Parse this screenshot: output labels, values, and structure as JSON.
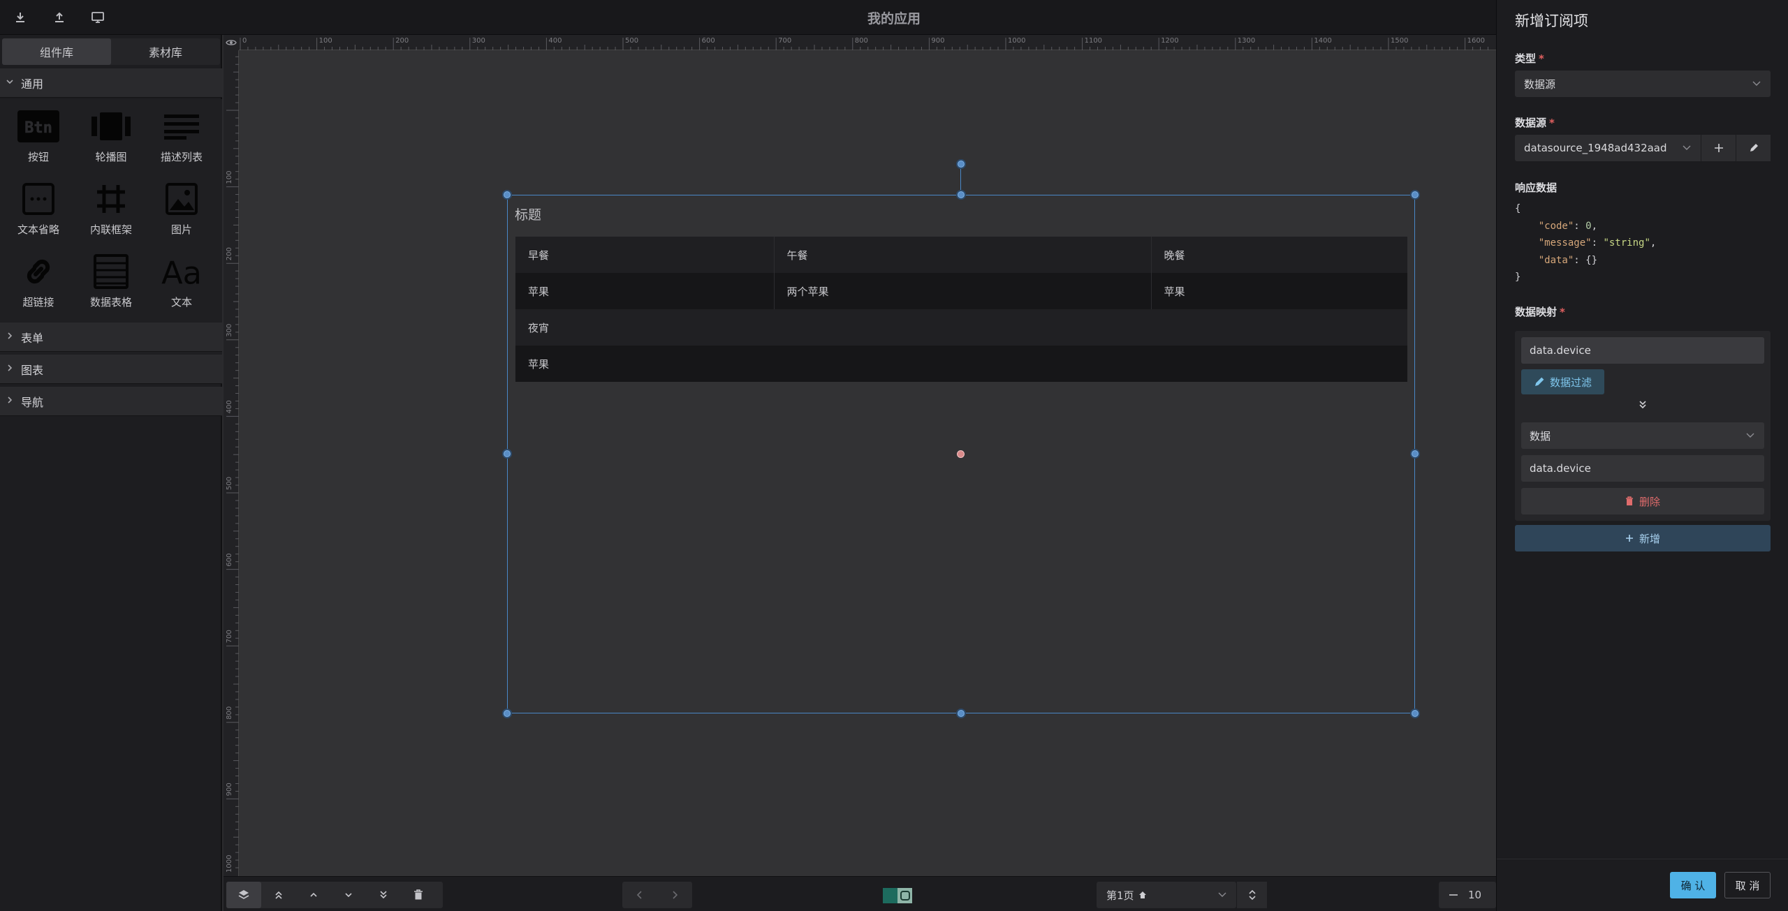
{
  "app": {
    "title": "我的应用"
  },
  "toolbar": {
    "icons": [
      "download-icon",
      "upload-icon",
      "preview-icon"
    ]
  },
  "library": {
    "tabs": [
      {
        "label": "组件库",
        "active": true
      },
      {
        "label": "素材库",
        "active": false
      }
    ],
    "sections": [
      {
        "label": "通用",
        "expanded": true
      },
      {
        "label": "表单",
        "expanded": false
      },
      {
        "label": "图表",
        "expanded": false
      },
      {
        "label": "导航",
        "expanded": false
      }
    ],
    "components": [
      {
        "label": "按钮",
        "icon": "button-icon",
        "icon_text": "Btn"
      },
      {
        "label": "轮播图",
        "icon": "carousel-icon"
      },
      {
        "label": "描述列表",
        "icon": "description-list-icon"
      },
      {
        "label": "文本省略",
        "icon": "text-ellipsis-icon"
      },
      {
        "label": "内联框架",
        "icon": "iframe-icon"
      },
      {
        "label": "图片",
        "icon": "image-icon"
      },
      {
        "label": "超链接",
        "icon": "link-icon"
      },
      {
        "label": "数据表格",
        "icon": "data-table-icon"
      },
      {
        "label": "文本",
        "icon": "text-icon",
        "icon_text": "Aa"
      }
    ]
  },
  "ruler": {
    "top_labels": [
      "0",
      "100",
      "200",
      "300",
      "400",
      "500",
      "600",
      "700",
      "800",
      "900",
      "1000",
      "1100",
      "1200",
      "1300",
      "1400",
      "1500",
      "1600"
    ],
    "left_labels": [
      "100",
      "200",
      "300",
      "400",
      "500",
      "600",
      "700",
      "800",
      "900",
      "1000"
    ]
  },
  "widget": {
    "title": "标题",
    "table": {
      "headers": [
        "早餐",
        "午餐",
        "晚餐"
      ],
      "rows": [
        [
          "苹果",
          "两个苹果",
          "苹果"
        ],
        [
          "夜宵",
          "",
          ""
        ],
        [
          "苹果",
          "",
          ""
        ]
      ]
    }
  },
  "bottombar": {
    "page_label": "第1页",
    "zoom": "10",
    "swatch_colors": [
      "#1d6b5e",
      "#8fb5a8"
    ]
  },
  "panel": {
    "title": "新增订阅项",
    "type_label": "类型",
    "type_value": "数据源",
    "datasource_label": "数据源",
    "datasource_value": "datasource_1948ad432aad",
    "response_label": "响应数据",
    "response_lines": [
      {
        "text": "{"
      },
      {
        "key": "\"code\"",
        "value": "0",
        "kind": "n"
      },
      {
        "key": "\"message\"",
        "value": "\"string\"",
        "kind": "s"
      },
      {
        "key": "\"data\"",
        "value": "{}",
        "kind": "p",
        "last": true
      },
      {
        "text": "}"
      }
    ],
    "mapping_label": "数据映射",
    "mapping_source": "data.device",
    "filter_label": "数据过滤",
    "mapping_target_type": "数据",
    "mapping_target": "data.device",
    "delete_label": "删除",
    "add_label": "新增",
    "ok_label": "确 认",
    "cancel_label": "取 消"
  }
}
